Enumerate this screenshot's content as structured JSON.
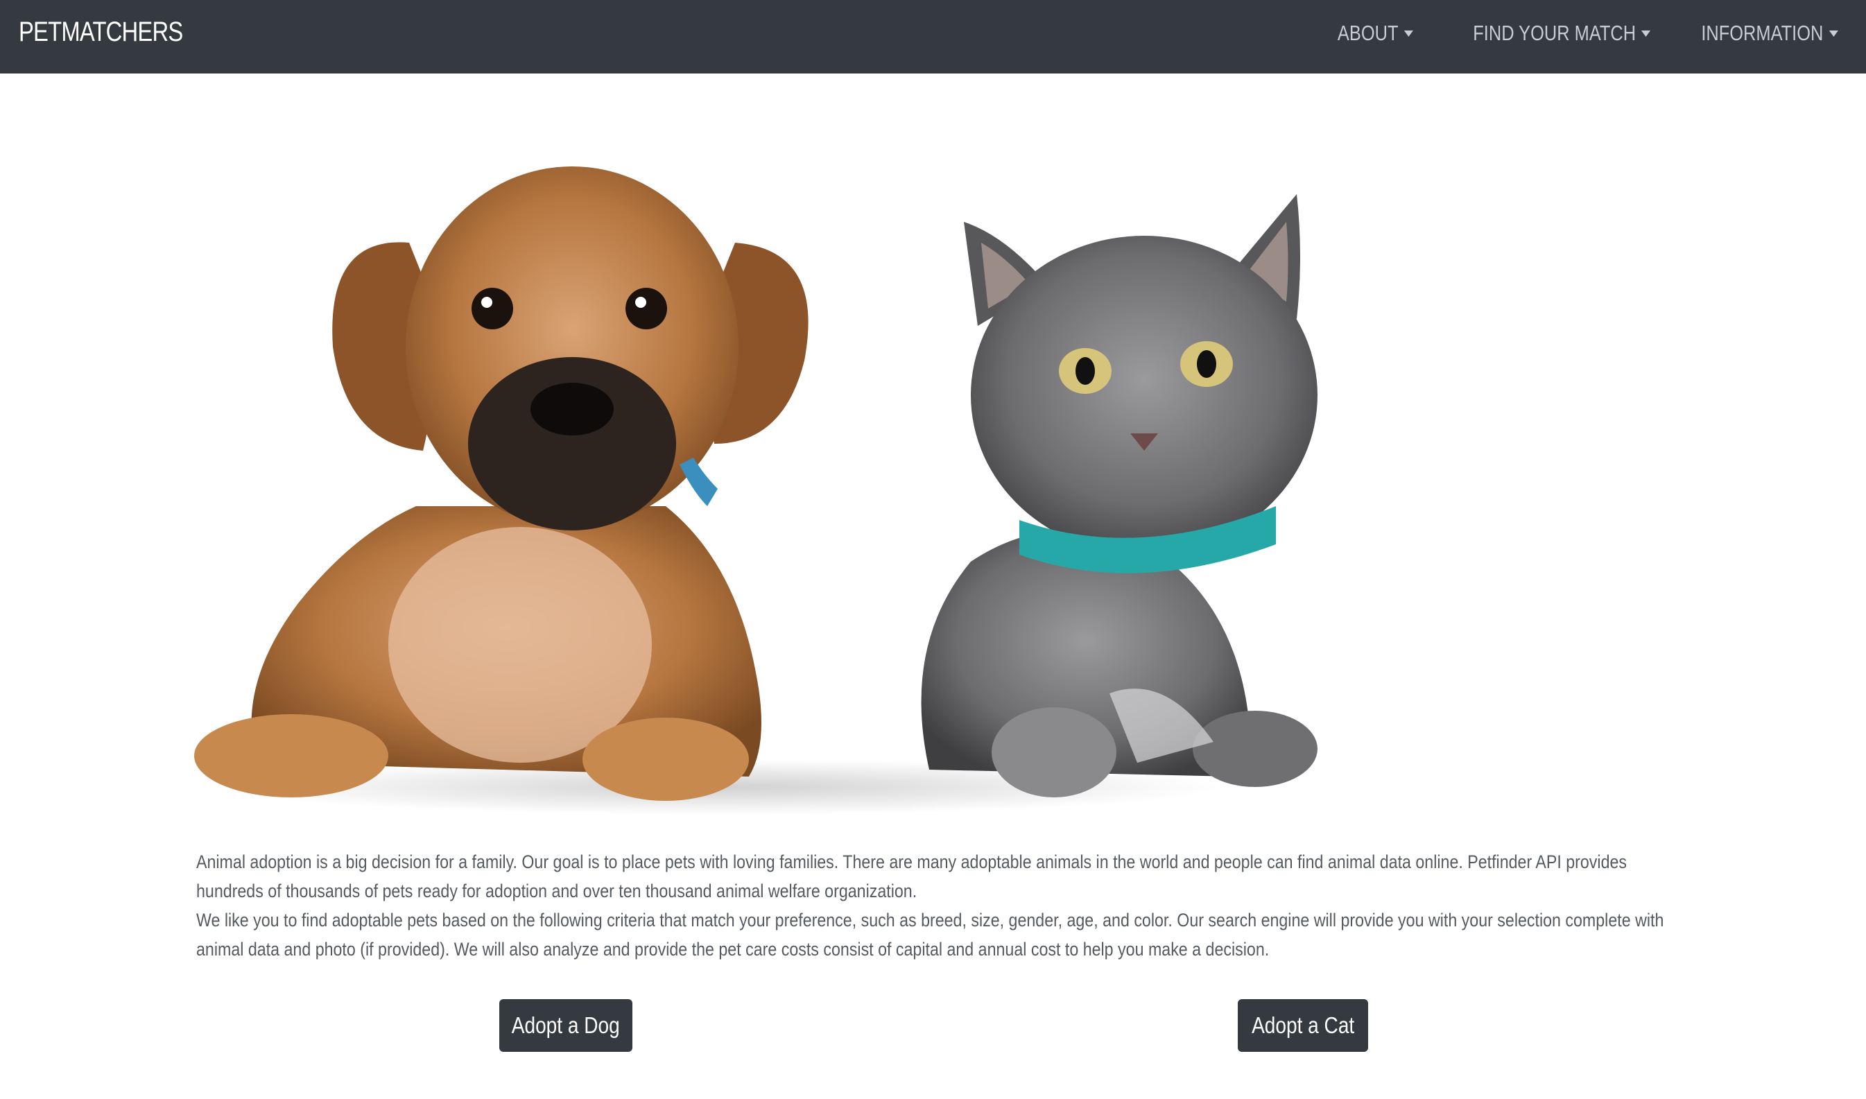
{
  "navbar": {
    "brand": "PETMATCHERS",
    "items": [
      {
        "label": "ABOUT"
      },
      {
        "label": "FIND YOUR MATCH"
      },
      {
        "label": "INFORMATION"
      }
    ]
  },
  "hero": {
    "image": "puppy-and-kitten-photo"
  },
  "content": {
    "paragraph1": "Animal adoption is a big decision for a family. Our goal is to place pets with loving families. There are many adoptable animals in the world and people can find animal data online. Petfinder API provides hundreds of thousands of pets ready for adoption and over ten thousand animal welfare organization.",
    "paragraph2": "We like you to find adoptable pets based on the following criteria that match your preference, such as breed, size, gender, age, and color. Our search engine will provide you with your selection complete with animal data and photo (if provided). We will also analyze and provide the pet care costs consist of capital and annual cost to help you make a decision."
  },
  "actions": {
    "adopt_dog": "Adopt a Dog",
    "adopt_cat": "Adopt a Cat"
  },
  "colors": {
    "navbar": "#343a40",
    "nav_text": "#c8cdd2",
    "button": "#343a40"
  }
}
